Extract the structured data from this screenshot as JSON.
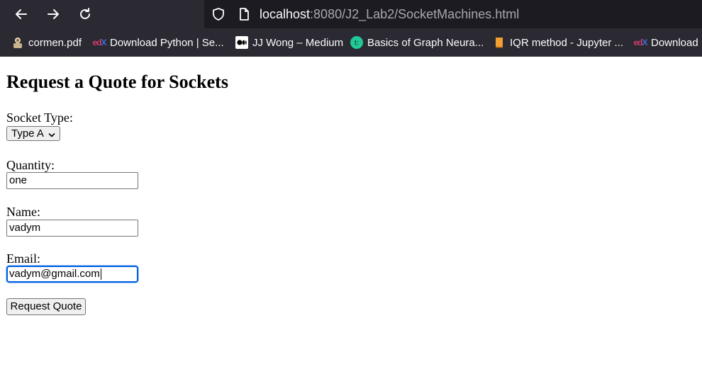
{
  "browser": {
    "url_host": "localhost",
    "url_path": ":8080/J2_Lab2/SocketMachines.html",
    "bookmarks": [
      {
        "label": "cormen.pdf",
        "icon": "pdf-avatar-icon"
      },
      {
        "label": "Download Python | Se...",
        "icon": "edx-icon"
      },
      {
        "label": "JJ Wong – Medium",
        "icon": "medium-icon"
      },
      {
        "label": "Basics of Graph Neura...",
        "icon": "teal-t-icon"
      },
      {
        "label": "IQR method - Jupyter ...",
        "icon": "book-icon"
      },
      {
        "label": "Download",
        "icon": "edx-icon"
      }
    ]
  },
  "page": {
    "title": "Request a Quote for Sockets",
    "socket_type_label": "Socket Type:",
    "socket_type_value": "Type A",
    "quantity_label": "Quantity:",
    "quantity_value": "one",
    "name_label": "Name:",
    "name_value": "vadym",
    "email_label": "Email:",
    "email_value": "vadym@gmail.com",
    "submit_label": "Request Quote"
  },
  "colors": {
    "chrome_bg": "#2b2a33",
    "urlbar_bg": "#1c1b22",
    "focus_ring": "#0060df"
  }
}
